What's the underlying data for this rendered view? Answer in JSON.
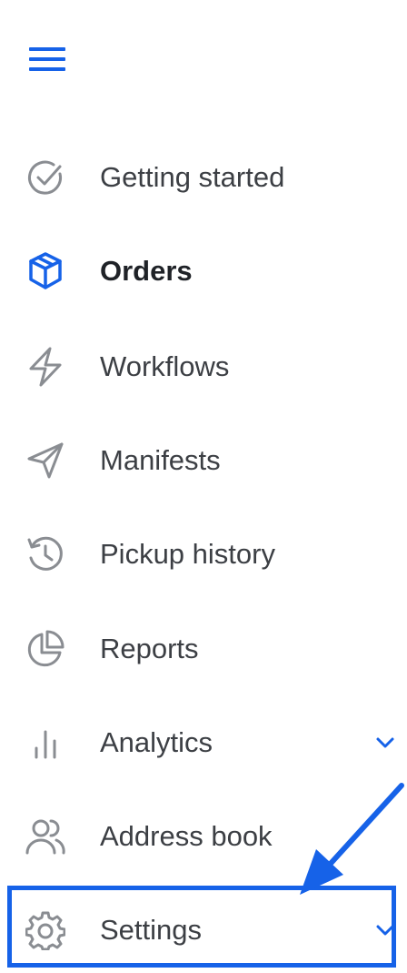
{
  "sidebar": {
    "items": [
      {
        "label": "Getting started",
        "icon": "check-circle-icon"
      },
      {
        "label": "Orders",
        "icon": "box-icon",
        "active": true
      },
      {
        "label": "Workflows",
        "icon": "lightning-icon"
      },
      {
        "label": "Manifests",
        "icon": "send-icon"
      },
      {
        "label": "Pickup history",
        "icon": "history-icon"
      },
      {
        "label": "Reports",
        "icon": "pie-chart-icon"
      },
      {
        "label": "Analytics",
        "icon": "bar-chart-icon",
        "expandable": true
      },
      {
        "label": "Address book",
        "icon": "users-icon"
      },
      {
        "label": "Settings",
        "icon": "gear-icon",
        "expandable": true,
        "highlighted": true
      }
    ]
  },
  "colors": {
    "accent": "#1662e8",
    "icon_gray": "#8a8d92",
    "text": "#3c3f44",
    "active_text": "#1f2227"
  }
}
